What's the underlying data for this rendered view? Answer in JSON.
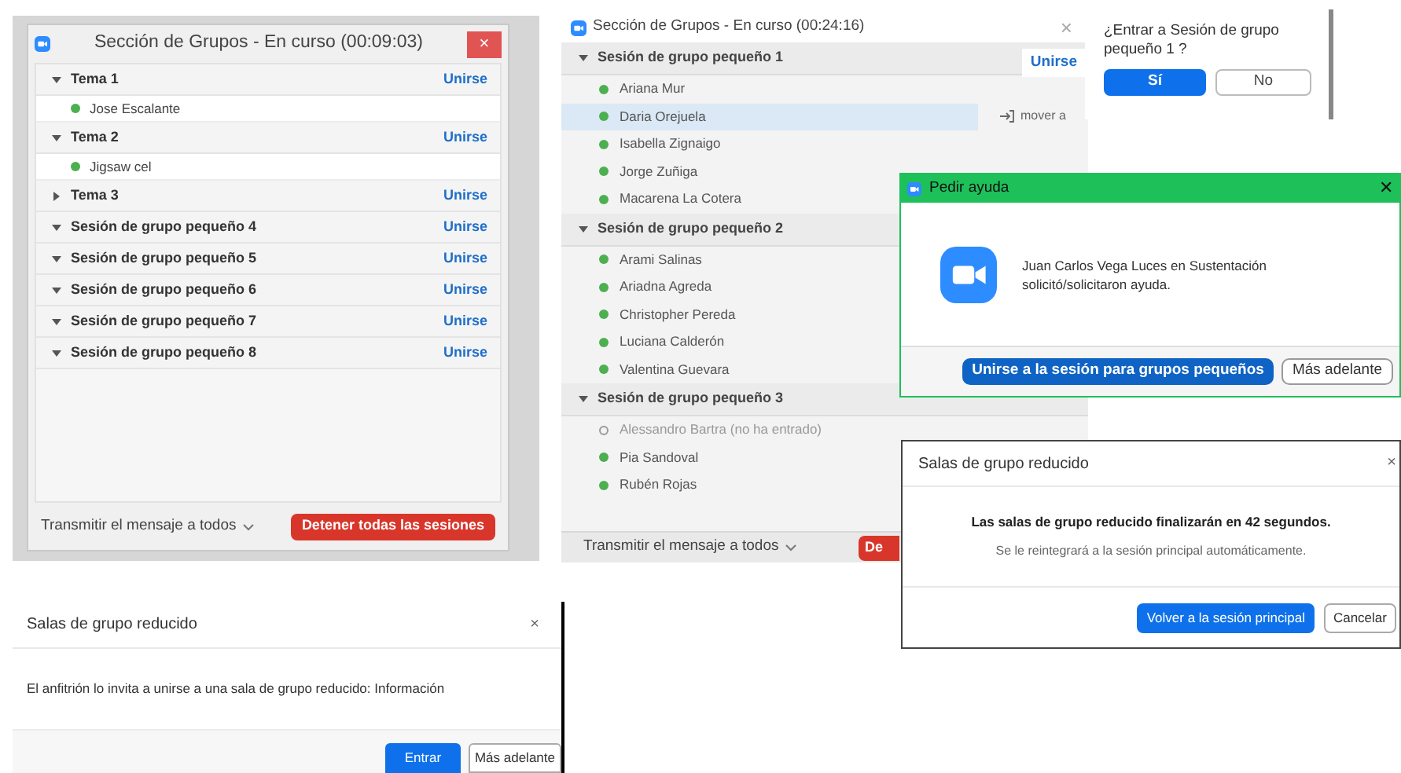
{
  "breakout_panel_1": {
    "title": "Sección de Grupos - En curso (00:09:03)",
    "close": "×",
    "groups": [
      {
        "name": "Tema 1",
        "expanded": true,
        "join": "Unirse",
        "participants": [
          {
            "name": "Jose Escalante",
            "joined": true
          }
        ]
      },
      {
        "name": "Tema 2",
        "expanded": true,
        "join": "Unirse",
        "participants": [
          {
            "name": "Jigsaw cel",
            "joined": true
          }
        ]
      },
      {
        "name": "Tema 3",
        "expanded": false,
        "join": "Unirse"
      },
      {
        "name": "Sesión de grupo pequeño 4",
        "expanded": true,
        "join": "Unirse"
      },
      {
        "name": "Sesión de grupo pequeño 5",
        "expanded": true,
        "join": "Unirse"
      },
      {
        "name": "Sesión de grupo pequeño 6",
        "expanded": true,
        "join": "Unirse"
      },
      {
        "name": "Sesión de grupo pequeño 7",
        "expanded": true,
        "join": "Unirse"
      },
      {
        "name": "Sesión de grupo pequeño 8",
        "expanded": true,
        "join": "Unirse"
      }
    ],
    "broadcast": "Transmitir el mensaje a todos",
    "stop_button": "Detener todas las sesiones"
  },
  "breakout_panel_2": {
    "title": "Sección de Grupos - En curso (00:24:16)",
    "close": "×",
    "groups": [
      {
        "name": "Sesión de grupo pequeño 1",
        "expanded": true,
        "join": "Unirse",
        "participants": [
          {
            "name": "Ariana Mur",
            "joined": true,
            "selected": false
          },
          {
            "name": "Daria Orejuela",
            "joined": true,
            "selected": true,
            "move_to": "mover a"
          },
          {
            "name": "Isabella Zignaigo",
            "joined": true,
            "selected": false
          },
          {
            "name": "Jorge Zuñiga",
            "joined": true,
            "selected": false
          },
          {
            "name": "Macarena La Cotera",
            "joined": true,
            "selected": false
          }
        ]
      },
      {
        "name": "Sesión de grupo pequeño 2",
        "expanded": true,
        "participants": [
          {
            "name": "Arami Salinas",
            "joined": true,
            "selected": false
          },
          {
            "name": "Ariadna Agreda",
            "joined": true,
            "selected": false
          },
          {
            "name": "Christopher Pereda",
            "joined": true,
            "selected": false
          },
          {
            "name": "Luciana Calderón",
            "joined": true,
            "selected": false
          },
          {
            "name": "Valentina Guevara",
            "joined": true,
            "selected": false
          }
        ]
      },
      {
        "name": "Sesión de grupo pequeño 3",
        "expanded": true,
        "participants": [
          {
            "name": "Alessandro Bartra (no ha entrado)",
            "joined": false,
            "selected": false
          },
          {
            "name": "Pia Sandoval",
            "joined": true,
            "selected": false
          },
          {
            "name": "Rubén Rojas",
            "joined": true,
            "selected": false
          }
        ]
      }
    ],
    "broadcast": "Transmitir el mensaje a todos",
    "stop_button": "De"
  },
  "join_prompt": {
    "question": "¿Entrar a Sesión de grupo pequeño 1 ?",
    "buttons": [
      "Sí",
      "No"
    ]
  },
  "help_request": {
    "title": "Pedir ayuda",
    "close": "✕",
    "message": "Juan Carlos Vega Luces en Sustentación solicitó/solicitaron ayuda.",
    "buttons": [
      "Unirse a la sesión para grupos pequeños",
      "Más adelante"
    ]
  },
  "closing_notice": {
    "title": "Salas de grupo reducido",
    "close": "×",
    "message": "Las salas de grupo reducido finalizarán en 42 segundos.",
    "detail": "Se le reintegrará a la sesión principal automáticamente.",
    "buttons": [
      "Volver a la sesión principal",
      "Cancelar"
    ]
  },
  "invitation": {
    "title": "Salas de grupo reducido",
    "close": "×",
    "message": "El anfitrión lo invita a unirse a una sala de grupo reducido: Información",
    "buttons": [
      "Entrar",
      "Más adelante"
    ]
  }
}
